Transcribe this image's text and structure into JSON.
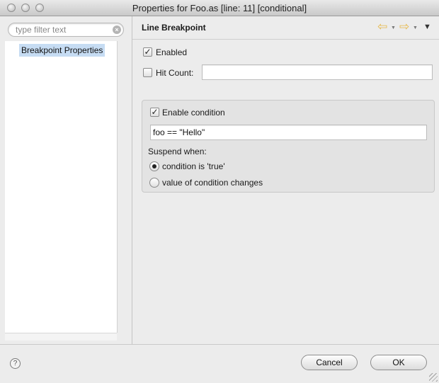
{
  "window": {
    "title": "Properties for Foo.as [line: 11] [conditional]"
  },
  "left": {
    "filter": {
      "placeholder": "type filter text",
      "value": ""
    },
    "tree_items": [
      {
        "label": "Breakpoint Properties",
        "selected": true
      }
    ]
  },
  "header": {
    "title": "Line Breakpoint",
    "icons": [
      "back-arrow-icon",
      "forward-arrow-icon",
      "view-menu-icon"
    ]
  },
  "form": {
    "enabled": {
      "label": "Enabled",
      "checked": true
    },
    "hit_count": {
      "label": "Hit Count:",
      "checked": false,
      "value": ""
    },
    "condition_group": {
      "enable_condition": {
        "label": "Enable condition",
        "checked": true
      },
      "expression": "foo == \"Hello\"",
      "suspend_when_label": "Suspend when:",
      "options": [
        {
          "label": "condition is 'true'",
          "selected": true
        },
        {
          "label": "value of condition changes",
          "selected": false
        }
      ]
    }
  },
  "buttons": {
    "cancel": "Cancel",
    "ok": "OK"
  },
  "colors": {
    "selection": "#c6dcf3",
    "nav_arrow": "#e6b84a"
  }
}
